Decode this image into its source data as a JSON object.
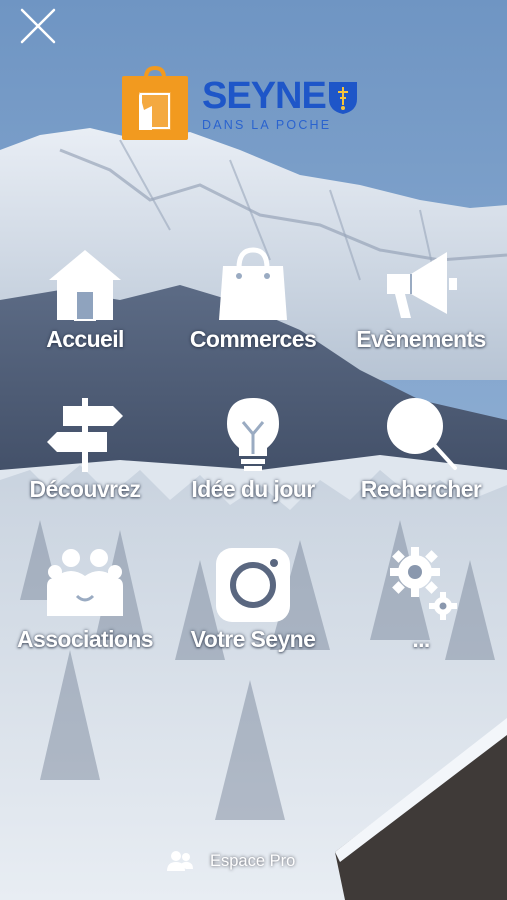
{
  "header": {
    "close_icon": "close-icon",
    "logo": {
      "title": "SEYNE",
      "subtitle": "DANS LA POCHE",
      "brand_orange": "#F29A1F",
      "brand_blue": "#1E56C8"
    }
  },
  "menu": {
    "items": [
      {
        "label": "Accueil",
        "icon": "home-icon"
      },
      {
        "label": "Commerces",
        "icon": "shopping-bag-icon"
      },
      {
        "label": "Evènements",
        "icon": "megaphone-icon"
      },
      {
        "label": "Découvrez",
        "icon": "signpost-icon"
      },
      {
        "label": "Idée du jour",
        "icon": "lightbulb-icon"
      },
      {
        "label": "Rechercher",
        "icon": "search-icon"
      },
      {
        "label": "Associations",
        "icon": "people-icon"
      },
      {
        "label": "Votre Seyne",
        "icon": "camera-icon"
      },
      {
        "label": "...",
        "icon": "settings-gear-icon"
      }
    ]
  },
  "footer": {
    "pro_label": "Espace Pro",
    "pro_icon": "professional-users-icon"
  },
  "colors": {
    "sky": "#7FA3C9",
    "text": "#FFFFFF"
  }
}
